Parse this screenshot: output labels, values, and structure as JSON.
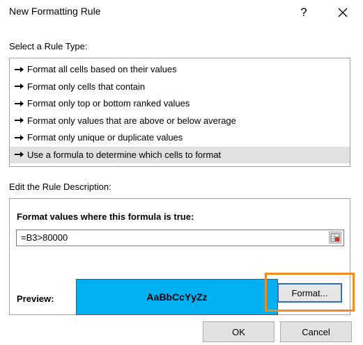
{
  "window": {
    "title": "New Formatting Rule",
    "help_label": "?"
  },
  "select_rule_type": {
    "label": "Select a Rule Type:",
    "items": [
      {
        "label": "Format all cells based on their values"
      },
      {
        "label": "Format only cells that contain"
      },
      {
        "label": "Format only top or bottom ranked values"
      },
      {
        "label": "Format only values that are above or below average"
      },
      {
        "label": "Format only unique or duplicate values"
      },
      {
        "label": "Use a formula to determine which cells to format",
        "selected": true
      }
    ]
  },
  "edit_rule": {
    "label": "Edit the Rule Description:",
    "formula_label": "Format values where this formula is true:",
    "formula_value": "=B3>80000",
    "preview_label": "Preview:",
    "preview_text": "AaBbCcYyZz",
    "preview_fill_color": "#00b0f0",
    "format_button_label": "Format..."
  },
  "footer": {
    "ok_label": "OK",
    "cancel_label": "Cancel"
  },
  "colors": {
    "highlight_outline": "#f28b1f",
    "selected_item_bg": "#e1e1e1"
  },
  "icons": {
    "close": "close-icon",
    "range_selector": "range-selector-icon",
    "list_bullet": "arrow-right-icon"
  }
}
